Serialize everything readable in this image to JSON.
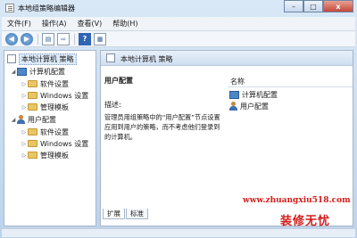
{
  "window": {
    "title": "本地组策略编辑器",
    "buttons": {
      "minimize": "–",
      "maximize": "□",
      "close": "x"
    }
  },
  "menubar": [
    {
      "label": "文件(F)"
    },
    {
      "label": "操作(A)"
    },
    {
      "label": "查看(V)"
    },
    {
      "label": "帮助(H)"
    }
  ],
  "toolbar": {
    "icons": [
      "back-arrow-icon",
      "forward-arrow-icon",
      "show-tree-icon",
      "export-list-icon",
      "help-icon",
      "properties-icon"
    ]
  },
  "tree": {
    "root": "本地计算机 策略",
    "computer": "计算机配置",
    "computer_children": [
      "软件设置",
      "Windows 设置",
      "管理模板"
    ],
    "user": "用户配置",
    "user_children": [
      "软件设置",
      "Windows 设置",
      "管理模板"
    ]
  },
  "right_pane": {
    "header": "本地计算机 策略",
    "section_title": "用户配置",
    "description_label": "描述:",
    "description": "管理员用组策略中的“用户配置”节点设置应用到用户的策略，而不考虑他们登录到的计算机。",
    "column_name": "名称",
    "items": [
      {
        "label": "计算机配置",
        "icon": "computer-icon"
      },
      {
        "label": "用户配置",
        "icon": "user-icon"
      }
    ],
    "tabs": [
      "扩展",
      "标准"
    ]
  },
  "watermark": {
    "url": "www.zhuangxiu518.com",
    "brand": "装修无忧"
  }
}
